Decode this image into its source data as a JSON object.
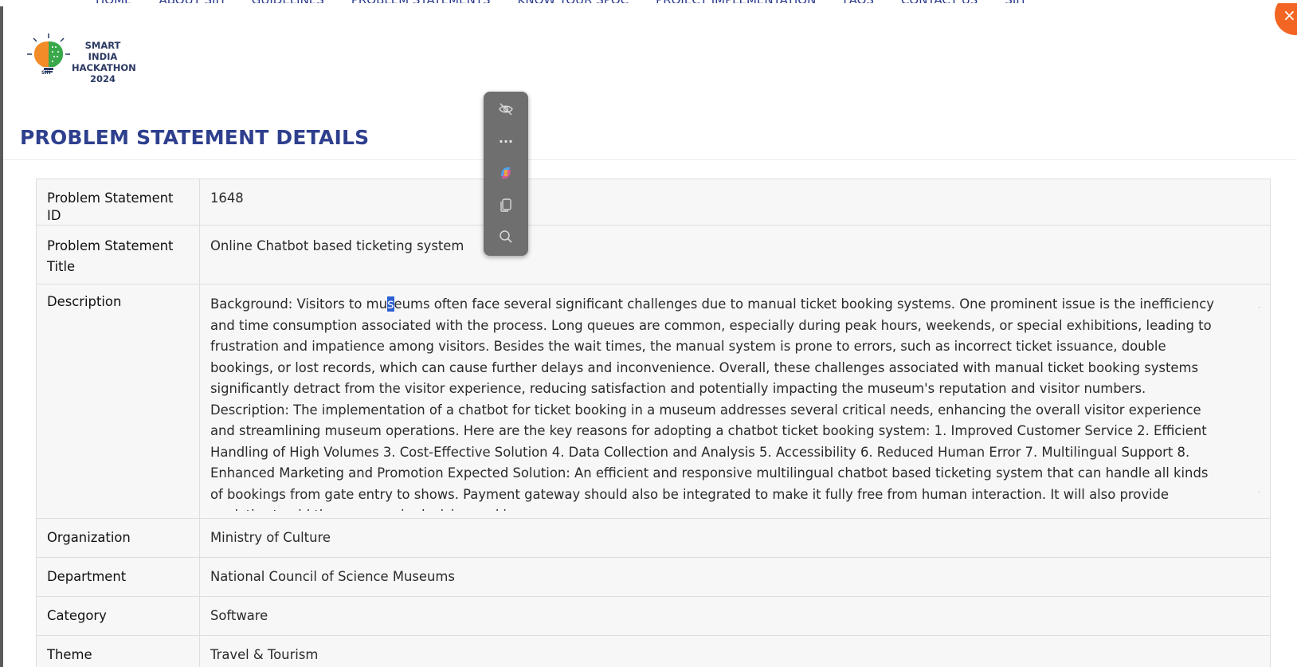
{
  "background_nav": {
    "items": [
      "HOME",
      "ABOUT SIH",
      "GUIDELINES",
      "PROBLEM STATEMENTS",
      "KNOW YOUR SPOC",
      "PROJECT IMPLEMENTATION",
      "FAQS",
      "CONTACT US",
      "SIH"
    ]
  },
  "modal": {
    "close_label": "×",
    "logo": {
      "line1": "SMART INDIA",
      "line2": "HACKATHON",
      "line3": "2024",
      "badge": "SIH"
    },
    "title": "PROBLEM STATEMENT DETAILS"
  },
  "details": {
    "id_label": "Problem Statement ID",
    "id_value": "1648",
    "title_label": "Problem Statement Title",
    "title_value": "Online Chatbot based ticketing system",
    "description_label": "Description",
    "description_before": "Background: Visitors to mu",
    "description_selected": "s",
    "description_after": "eums often face several significant challenges due to manual ticket booking systems. One prominent issue is the inefficiency and time consumption associated with the process. Long queues are common, especially during peak hours, weekends, or special exhibitions, leading to frustration and impatience among visitors. Besides the wait times, the manual system is prone to errors, such as incorrect ticket issuance, double bookings, or lost records, which can cause further delays and inconvenience. Overall, these challenges associated with manual ticket booking systems significantly detract from the visitor experience, reducing satisfaction and potentially impacting the museum's reputation and visitor numbers. Description: The implementation of a chatbot for ticket booking in a museum addresses several critical needs, enhancing the overall visitor experience and streamlining museum operations. Here are the key reasons for adopting a chatbot ticket booking system: 1. Improved Customer Service 2. Efficient Handling of High Volumes 3. Cost-Effective Solution 4. Data Collection and Analysis 5. Accessibility 6. Reduced Human Error 7. Multilingual Support 8. Enhanced Marketing and Promotion Expected Solution: An efficient and responsive multilingual chatbot based ticketing system that can handle all kinds of bookings from gate entry to shows. Payment gateway should also be integrated to make it fully free from human interaction. It will also provide analytics to aid the museum in decision making.",
    "organization_label": "Organization",
    "organization_value": "Ministry of Culture",
    "department_label": "Department",
    "department_value": "National Council of Science Museums",
    "category_label": "Category",
    "category_value": "Software",
    "theme_label": "Theme",
    "theme_value": "Travel & Tourism"
  },
  "mini_toolbar": {
    "tools": [
      "hide-icon",
      "more-icon",
      "copilot-icon",
      "copy-icon",
      "search-icon"
    ],
    "more_glyph": "···"
  },
  "colors": {
    "title": "#2e3f8e",
    "close": "#f26522",
    "selection": "#2d5fd3"
  }
}
